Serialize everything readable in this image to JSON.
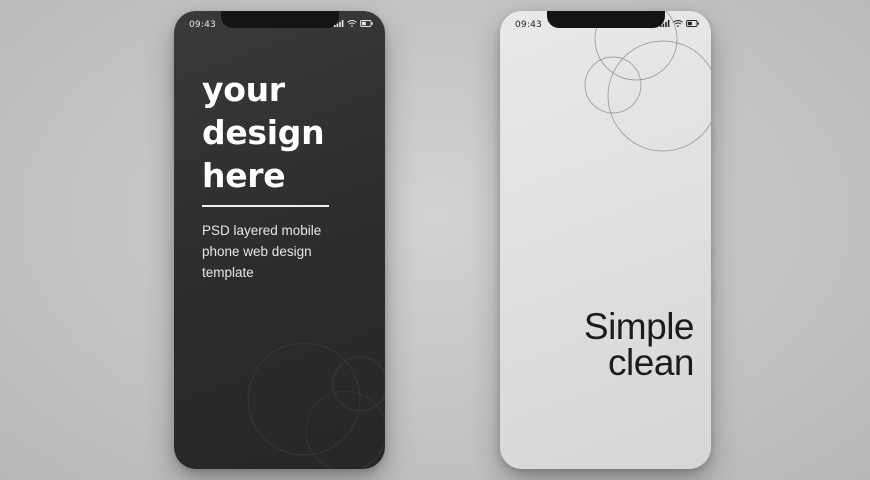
{
  "phones": [
    {
      "status_time": "09:43",
      "headline_lines": [
        "your",
        "design",
        "here"
      ],
      "subtext_lines": [
        "PSD layered mobile",
        "phone web design",
        "template"
      ]
    },
    {
      "status_time": "09:43",
      "tagline_lines": [
        "Simple",
        "clean"
      ]
    }
  ],
  "colors": {
    "background": "#c6c6c6",
    "dark_phone": "#2f2f2f",
    "light_phone": "#e2e2e2"
  },
  "icons": [
    "signal-icon",
    "wifi-icon",
    "battery-icon"
  ]
}
